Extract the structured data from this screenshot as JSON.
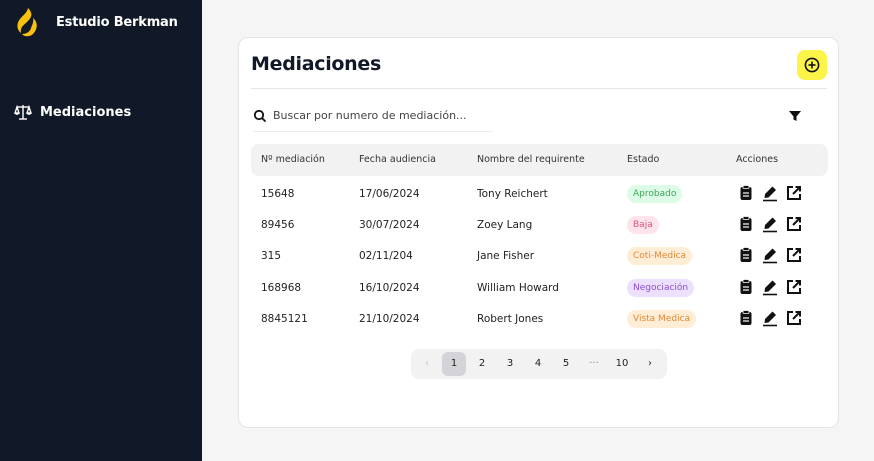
{
  "sidebar": {
    "brand": "Estudio Berkman",
    "nav": [
      {
        "label": "Mediaciones",
        "icon": "scale-icon"
      }
    ]
  },
  "card": {
    "title": "Mediaciones",
    "search_placeholder": "Buscar por numero de mediación..."
  },
  "table": {
    "columns": [
      "Nº mediación",
      "Fecha audiencia",
      "Nombre del requirente",
      "Estado",
      "Acciones"
    ],
    "rows": [
      {
        "numero": "15648",
        "fecha": "17/06/2024",
        "nombre": "Tony Reichert",
        "estado": "Aprobado"
      },
      {
        "numero": "89456",
        "fecha": "30/07/2024",
        "nombre": "Zoey Lang",
        "estado": "Baja"
      },
      {
        "numero": "315",
        "fecha": "02/11/204",
        "nombre": "Jane Fisher",
        "estado": "Coti-Medica"
      },
      {
        "numero": "168968",
        "fecha": "16/10/2024",
        "nombre": "William Howard",
        "estado": "Negociación"
      },
      {
        "numero": "8845121",
        "fecha": "21/10/2024",
        "nombre": "Robert Jones",
        "estado": "Vista Medica"
      }
    ]
  },
  "pagination": {
    "prev": "‹",
    "pages": [
      "1",
      "2",
      "3",
      "4",
      "5"
    ],
    "ellipsis": "···",
    "last": "10",
    "next": "›",
    "current": "1"
  },
  "colors": {
    "sidebar_bg": "#111827",
    "accent_yellow": "#fdf44a",
    "badge_aprobado": "#dcfce7",
    "badge_baja": "#ffe4ec",
    "badge_coti": "#ffedd5",
    "badge_negociacion": "#ede0ff",
    "badge_vista": "#ffedd5"
  }
}
